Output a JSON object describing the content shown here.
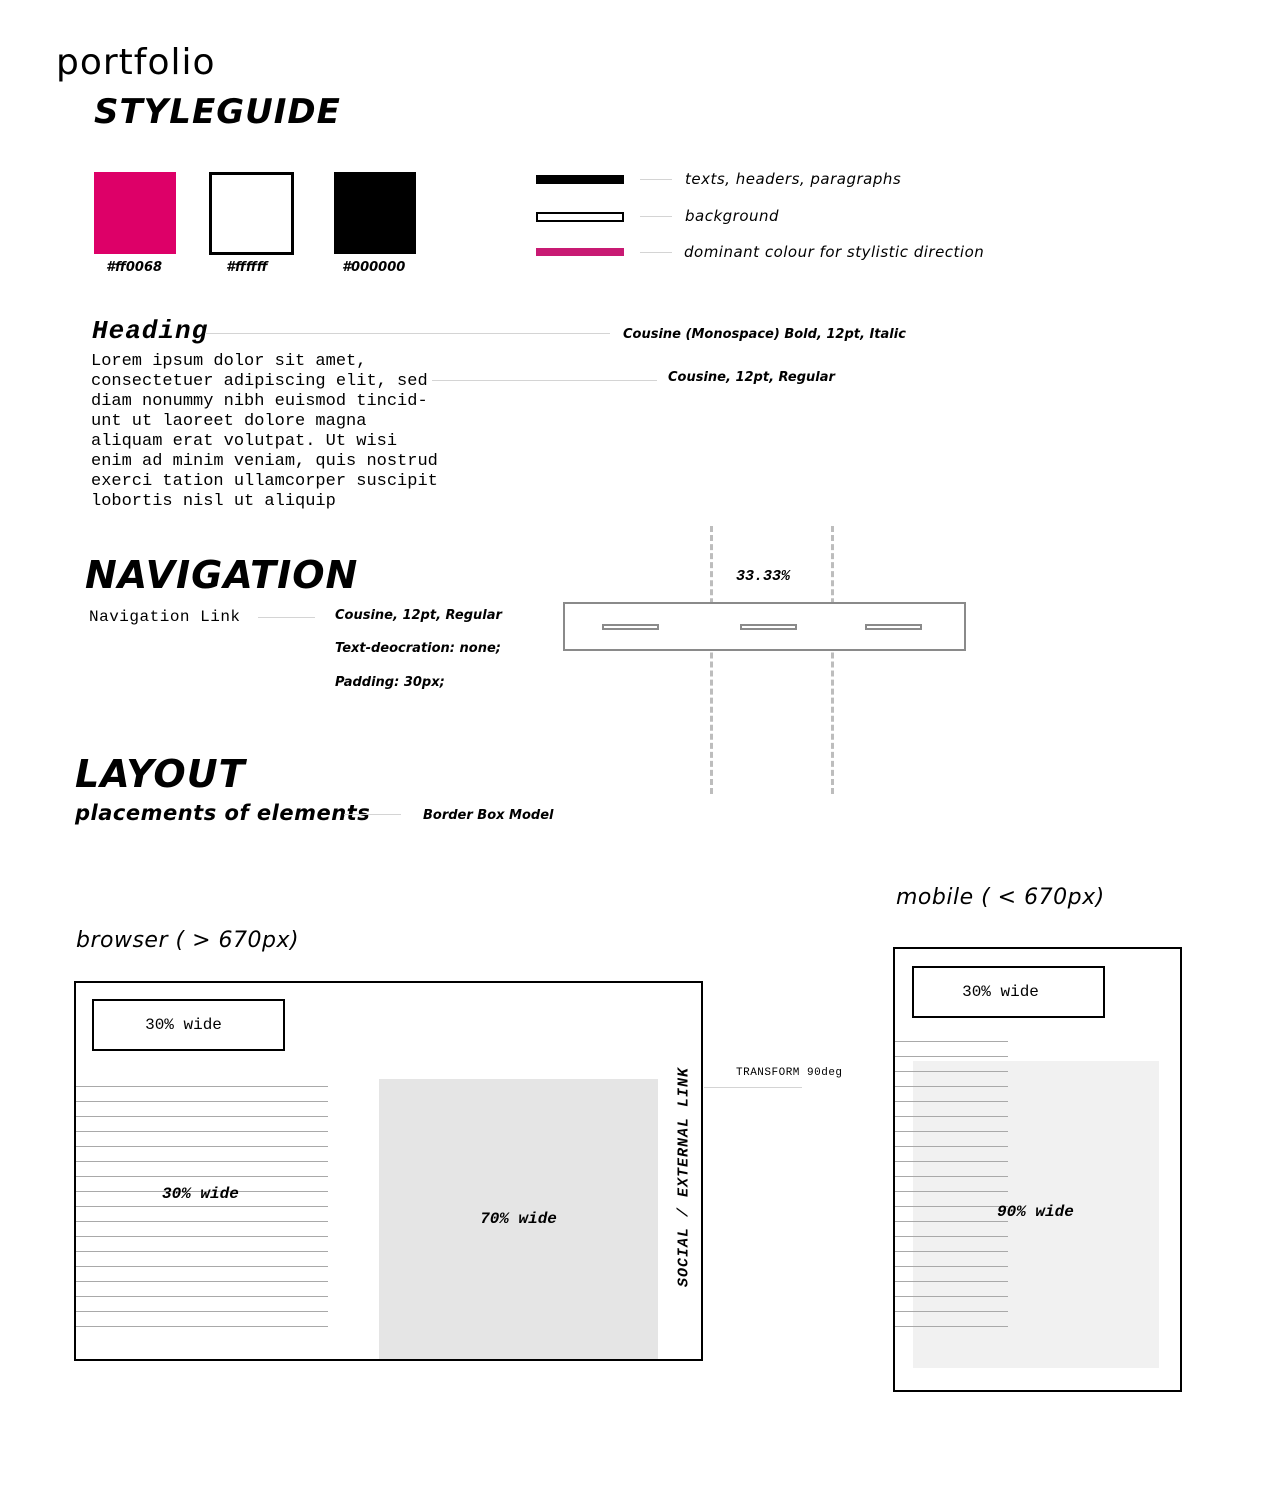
{
  "header": {
    "title": "portfolio",
    "subtitle": "STYLEGUIDE"
  },
  "colors": [
    {
      "hex_label": "#ff0068",
      "value": "#dd0068"
    },
    {
      "hex_label": "#ffffff",
      "value": "#ffffff"
    },
    {
      "hex_label": "#000000",
      "value": "#000000"
    }
  ],
  "color_usage": [
    "texts, headers, paragraphs",
    "background",
    "dominant colour for stylistic direction"
  ],
  "typography": {
    "heading_sample": "Heading",
    "heading_spec": "Cousine (Monospace) Bold, 12pt, Italic",
    "body_sample": "Lorem ipsum dolor sit amet,\nconsectetuer adipiscing elit, sed\ndiam nonummy nibh euismod tincid-\nunt ut laoreet dolore magna\naliquam erat volutpat. Ut wisi\nenim ad minim veniam, quis nostrud\nexerci tation ullamcorper suscipit\nlobortis nisl ut aliquip",
    "body_spec": "Cousine, 12pt, Regular"
  },
  "navigation": {
    "title": "NAVIGATION",
    "link_sample": "Navigation Link",
    "specs": [
      "Cousine, 12pt, Regular",
      "Text-deocration: none;",
      "Padding: 30px;"
    ],
    "column_width": "33.33%"
  },
  "layout": {
    "title": "LAYOUT",
    "subtitle": "placements of elements",
    "model": "Border Box Model",
    "browser": {
      "caption": "browser ( > 670px)",
      "top_box": "30% wide",
      "left_col": "30% wide",
      "right_col": "70% wide",
      "side_link": "SOCIAL / EXTERNAL LINK",
      "transform_note": "TRANSFORM 90deg"
    },
    "mobile": {
      "caption": "mobile ( < 670px)",
      "top_box": "30% wide",
      "main": "90% wide"
    }
  }
}
